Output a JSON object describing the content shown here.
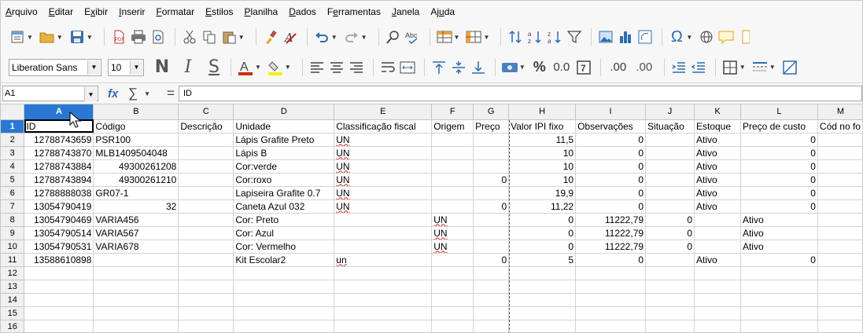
{
  "menu": [
    "Arquivo",
    "Editar",
    "Exibir",
    "Inserir",
    "Formatar",
    "Estilos",
    "Planilha",
    "Dados",
    "Ferramentas",
    "Janela",
    "Ajuda"
  ],
  "menu_underline": [
    0,
    0,
    1,
    0,
    0,
    0,
    0,
    0,
    1,
    0,
    2
  ],
  "toolbar": {
    "font_name": "Liberation Sans",
    "font_size": "10",
    "bold": "N",
    "italic": "I",
    "underline": "S",
    "percent": "%",
    "decimal": "0.0",
    "add_decimal": ".00",
    "remove_decimal": ".00",
    "special_char": "Ω"
  },
  "formula_bar": {
    "cell_ref": "A1",
    "fx": "fx",
    "sigma": "∑",
    "equals": "=",
    "content": "ID"
  },
  "columns": [
    "A",
    "B",
    "C",
    "D",
    "E",
    "F",
    "G",
    "H",
    "I",
    "J",
    "K",
    "L",
    "M"
  ],
  "rows": [
    [
      "ID",
      "Código",
      "Descrição",
      "Unidade",
      "Classificação fiscal",
      "Origem",
      "Preço",
      "Valor IPI fixo",
      "Observações",
      "Situação",
      "Estoque",
      "Preço de custo",
      "Cód no fo"
    ],
    [
      "12788743659",
      "PSR100",
      "",
      "Lápis Grafite Preto",
      "UN",
      "",
      "",
      "11,5",
      "0",
      "",
      "Ativo",
      "0",
      ""
    ],
    [
      "12788743870",
      "MLB1409504048",
      "",
      "Lápis B",
      "UN",
      "",
      "",
      "10",
      "0",
      "",
      "Ativo",
      "0",
      ""
    ],
    [
      "12788743884",
      "49300261208",
      "",
      "Cor:verde",
      "UN",
      "",
      "",
      "10",
      "0",
      "",
      "Ativo",
      "0",
      ""
    ],
    [
      "12788743894",
      "49300261210",
      "",
      "Cor:roxo",
      "UN",
      "",
      "0",
      "10",
      "0",
      "",
      "Ativo",
      "0",
      ""
    ],
    [
      "12788888038",
      "GR07-1",
      "",
      "Lapiseira Grafite 0.7",
      "UN",
      "",
      "",
      "19,9",
      "0",
      "",
      "Ativo",
      "0",
      ""
    ],
    [
      "13054790419",
      "32",
      "",
      "Caneta Azul 032",
      "UN",
      "",
      "0",
      "11,22",
      "0",
      "",
      "Ativo",
      "0",
      ""
    ],
    [
      "13054790469",
      "VARIA456",
      "",
      "Cor: Preto",
      "",
      "UN",
      "",
      "0",
      "11222,79",
      "0",
      "",
      "Ativo",
      ""
    ],
    [
      "13054790514",
      "VARIA567",
      "",
      "Cor: Azul",
      "",
      "UN",
      "",
      "0",
      "11222,79",
      "0",
      "",
      "Ativo",
      ""
    ],
    [
      "13054790531",
      "VARIA678",
      "",
      "Cor: Vermelho",
      "",
      "UN",
      "",
      "0",
      "11222,79",
      "0",
      "",
      "Ativo",
      ""
    ],
    [
      "13588610898",
      "",
      "",
      "Kit Escolar2",
      "un",
      "",
      "0",
      "5",
      "0",
      "",
      "Ativo",
      "0",
      ""
    ],
    [
      "",
      "",
      "",
      "",
      "",
      "",
      "",
      "",
      "",
      "",
      "",
      "",
      ""
    ],
    [
      "",
      "",
      "",
      "",
      "",
      "",
      "",
      "",
      "",
      "",
      "",
      "",
      ""
    ],
    [
      "",
      "",
      "",
      "",
      "",
      "",
      "",
      "",
      "",
      "",
      "",
      "",
      ""
    ],
    [
      "",
      "",
      "",
      "",
      "",
      "",
      "",
      "",
      "",
      "",
      "",
      "",
      ""
    ],
    [
      "",
      "",
      "",
      "",
      "",
      "",
      "",
      "",
      "",
      "",
      "",
      "",
      ""
    ]
  ],
  "numeric_cells": [
    [
      1,
      0
    ],
    [
      2,
      0
    ],
    [
      3,
      0
    ],
    [
      4,
      0
    ],
    [
      5,
      0
    ],
    [
      6,
      0
    ],
    [
      7,
      0
    ],
    [
      8,
      0
    ],
    [
      9,
      0
    ],
    [
      10,
      0
    ],
    [
      3,
      1
    ],
    [
      4,
      1
    ],
    [
      6,
      1
    ],
    [
      4,
      6
    ],
    [
      6,
      6
    ],
    [
      10,
      6
    ],
    [
      1,
      7
    ],
    [
      2,
      7
    ],
    [
      3,
      7
    ],
    [
      4,
      7
    ],
    [
      5,
      7
    ],
    [
      6,
      7
    ],
    [
      7,
      7
    ],
    [
      8,
      7
    ],
    [
      9,
      7
    ],
    [
      10,
      7
    ],
    [
      1,
      8
    ],
    [
      2,
      8
    ],
    [
      3,
      8
    ],
    [
      4,
      8
    ],
    [
      5,
      8
    ],
    [
      6,
      8
    ],
    [
      7,
      8
    ],
    [
      8,
      8
    ],
    [
      9,
      8
    ],
    [
      10,
      8
    ],
    [
      7,
      9
    ],
    [
      8,
      9
    ],
    [
      9,
      9
    ],
    [
      1,
      11
    ],
    [
      2,
      11
    ],
    [
      3,
      11
    ],
    [
      4,
      11
    ],
    [
      5,
      11
    ],
    [
      6,
      11
    ],
    [
      10,
      11
    ]
  ],
  "squiggle_cells": [
    [
      1,
      4
    ],
    [
      2,
      4
    ],
    [
      3,
      4
    ],
    [
      4,
      4
    ],
    [
      5,
      4
    ],
    [
      6,
      4
    ],
    [
      10,
      4
    ],
    [
      7,
      5
    ],
    [
      8,
      5
    ],
    [
      9,
      5
    ]
  ],
  "colors": {
    "selection": "#2b78d4",
    "header_bg": "#f0f0f0",
    "grid_line": "#d4d4d4"
  }
}
